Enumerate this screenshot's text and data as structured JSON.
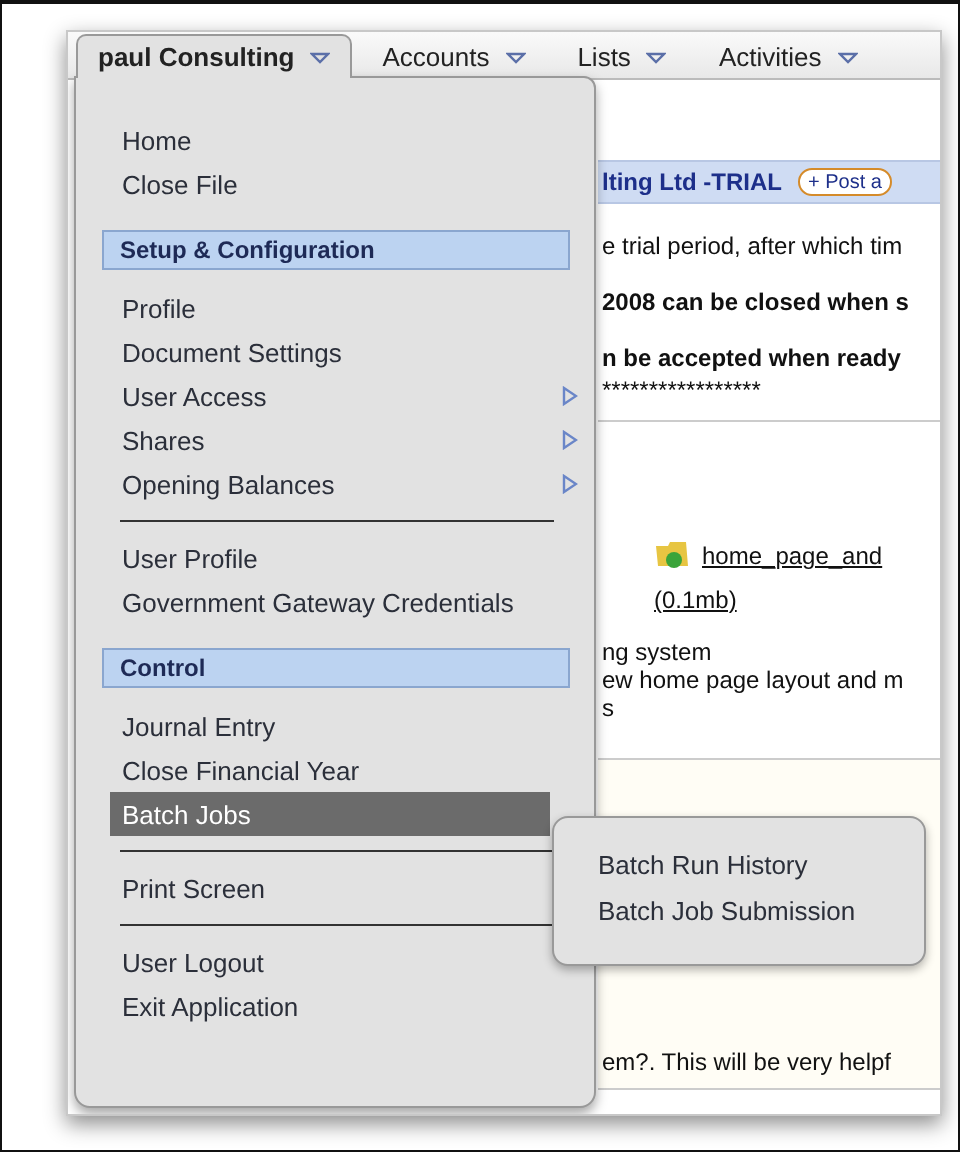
{
  "tabs": [
    {
      "label": "paul Consulting",
      "selected": true
    },
    {
      "label": "Accounts",
      "selected": false
    },
    {
      "label": "Lists",
      "selected": false
    },
    {
      "label": "Activities",
      "selected": false
    }
  ],
  "menu": {
    "items": [
      {
        "kind": "item",
        "label": "Home",
        "has_submenu": false,
        "selected": false
      },
      {
        "kind": "item",
        "label": "Close File",
        "has_submenu": false,
        "selected": false
      },
      {
        "kind": "header",
        "label": "Setup & Configuration"
      },
      {
        "kind": "item",
        "label": "Profile",
        "has_submenu": false,
        "selected": false
      },
      {
        "kind": "item",
        "label": "Document Settings",
        "has_submenu": false,
        "selected": false
      },
      {
        "kind": "item",
        "label": "User Access",
        "has_submenu": true,
        "selected": false
      },
      {
        "kind": "item",
        "label": "Shares",
        "has_submenu": true,
        "selected": false
      },
      {
        "kind": "item",
        "label": "Opening Balances",
        "has_submenu": true,
        "selected": false
      },
      {
        "kind": "divider"
      },
      {
        "kind": "item",
        "label": "User Profile",
        "has_submenu": false,
        "selected": false
      },
      {
        "kind": "item",
        "label": "Government Gateway Credentials",
        "has_submenu": false,
        "selected": false
      },
      {
        "kind": "header",
        "label": "Control"
      },
      {
        "kind": "item",
        "label": "Journal Entry",
        "has_submenu": false,
        "selected": false
      },
      {
        "kind": "item",
        "label": "Close Financial Year",
        "has_submenu": false,
        "selected": false
      },
      {
        "kind": "item",
        "label": "Batch Jobs",
        "has_submenu": false,
        "selected": true
      },
      {
        "kind": "divider"
      },
      {
        "kind": "item",
        "label": "Print Screen",
        "has_submenu": false,
        "selected": false
      },
      {
        "kind": "divider"
      },
      {
        "kind": "item",
        "label": "User Logout",
        "has_submenu": false,
        "selected": false
      },
      {
        "kind": "item",
        "label": "Exit Application",
        "has_submenu": false,
        "selected": false
      }
    ]
  },
  "submenu": {
    "items": [
      {
        "label": "Batch Run History"
      },
      {
        "label": "Batch Job Submission"
      }
    ]
  },
  "content": {
    "company_title": "lting Ltd -TRIAL",
    "post_button": "+ Post a",
    "notices": [
      {
        "text": "e trial period, after which tim",
        "bold": false
      },
      {
        "text": "2008 can be closed when s",
        "bold": true
      },
      {
        "text": "n be accepted when ready",
        "bold": true
      },
      {
        "text": "*****************",
        "bold": false
      }
    ],
    "attachment": {
      "link": "home_page_and",
      "size": "(0.1mb)"
    },
    "description": [
      "ng system",
      "ew home page layout and m",
      "s"
    ],
    "question": "em?. This will be very helpf"
  }
}
